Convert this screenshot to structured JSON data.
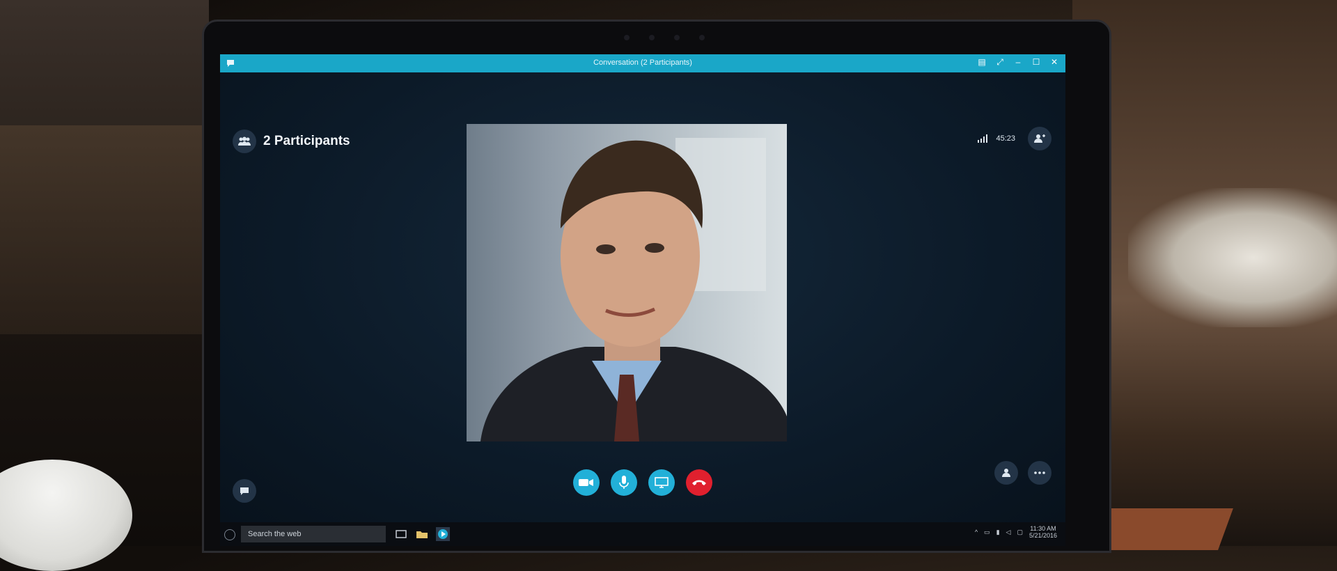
{
  "window": {
    "title": "Conversation (2 Participants)"
  },
  "call": {
    "participants_label": "2 Participants",
    "duration": "45:23"
  },
  "controls": {
    "video": "video-camera-icon",
    "mic": "microphone-icon",
    "share": "screen-share-icon",
    "end": "end-call-icon"
  },
  "taskbar": {
    "search_placeholder": "Search the web",
    "clock_time": "11:30 AM",
    "clock_date": "5/21/2016"
  },
  "colors": {
    "accent": "#1aa7c8",
    "end_call": "#e0202e",
    "call_bg": "#0c1a28"
  }
}
